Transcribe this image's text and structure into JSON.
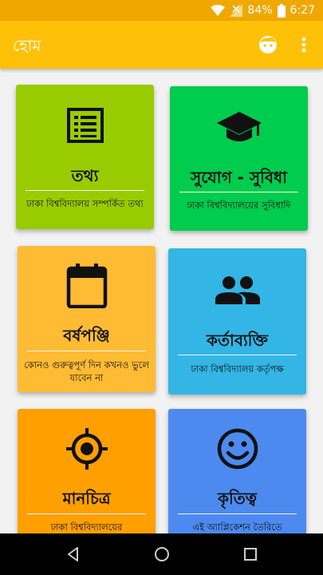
{
  "status_bar": {
    "battery": "84%",
    "time": "6:27"
  },
  "app_bar": {
    "title": "হোম",
    "profile_icon": "face-icon",
    "menu_icon": "more-vert-icon"
  },
  "cards": [
    {
      "title": "তথ্য",
      "description": "ঢাকা বিশ্ববিদ্যালয় সম্পর্কিত তথ্য",
      "icon": "list-icon",
      "color": "#99cc00"
    },
    {
      "title": "সুযোগ - সুবিধা",
      "description": "ঢাকা বিশ্ববিদ্যালয়ের সুবিধাদি",
      "icon": "graduation-cap-icon",
      "color": "#00cc4e"
    },
    {
      "title": "বর্ষপঞ্জি",
      "description": "কোনও গুরুত্বপূর্ণ দিন কখনও ভুলে যাবেন না",
      "icon": "calendar-icon",
      "color": "#ffbb33"
    },
    {
      "title": "কর্তাব্যক্তি",
      "description": "ঢাকা বিশ্ববিদ্যালয় কর্তৃপক্ষ",
      "icon": "people-icon",
      "color": "#33b5e5"
    },
    {
      "title": "মানচিত্র",
      "description": "ঢাকা বিশ্ববিদ্যালয়ের",
      "icon": "location-target-icon",
      "color": "#ffa000"
    },
    {
      "title": "কৃতিত্ব",
      "description": "এই অ্যাপ্লিকেশন তৈরিতে",
      "icon": "smiley-icon",
      "color": "#4d8af0"
    }
  ],
  "nav_bar": {
    "back_icon": "back-triangle-icon",
    "home_icon": "home-circle-icon",
    "recents_icon": "recents-square-icon"
  }
}
